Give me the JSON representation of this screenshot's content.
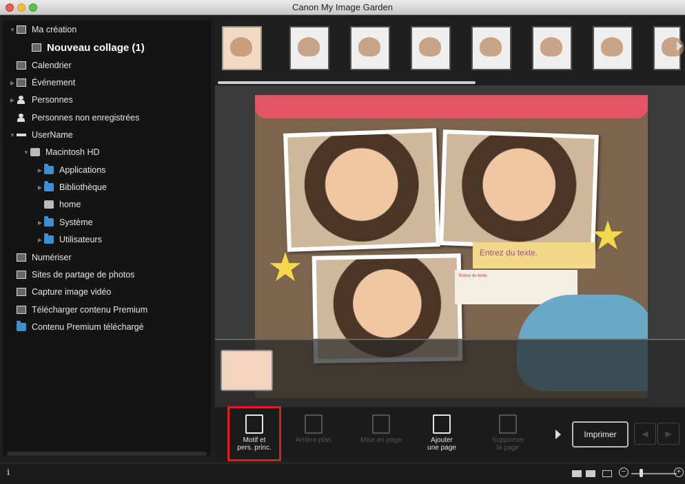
{
  "window": {
    "title": "Canon My Image Garden"
  },
  "sidebar": {
    "items": [
      {
        "label": "Ma création",
        "icon": "creation-icon",
        "level": 0,
        "expanded": true
      },
      {
        "label": "Nouveau collage (1)",
        "icon": "collage-icon",
        "level": 1,
        "selected": true
      },
      {
        "label": "Calendrier",
        "icon": "calendar-icon",
        "level": 0
      },
      {
        "label": "Événement",
        "icon": "event-icon",
        "level": 0
      },
      {
        "label": "Personnes",
        "icon": "people-icon",
        "level": 0
      },
      {
        "label": "Personnes non enregistrées",
        "icon": "unregistered-people-icon",
        "level": 0
      },
      {
        "label": "UserName",
        "icon": "drive-icon",
        "level": 0,
        "expanded": true
      },
      {
        "label": "Macintosh HD",
        "icon": "harddisk-icon",
        "level": 1,
        "expanded": true
      },
      {
        "label": "Applications",
        "icon": "folder-icon",
        "level": 2
      },
      {
        "label": "Bibliothèque",
        "icon": "folder-icon",
        "level": 2
      },
      {
        "label": "home",
        "icon": "home-icon",
        "level": 2
      },
      {
        "label": "Système",
        "icon": "folder-icon",
        "level": 2
      },
      {
        "label": "Utilisateurs",
        "icon": "folder-icon",
        "level": 2
      },
      {
        "label": "Numériser",
        "icon": "scan-icon",
        "level": 0
      },
      {
        "label": "Sites de partage de photos",
        "icon": "photo-share-icon",
        "level": 0
      },
      {
        "label": "Capture image vidéo",
        "icon": "video-capture-icon",
        "level": 0
      },
      {
        "label": "Télécharger contenu Premium",
        "icon": "download-premium-icon",
        "level": 0
      },
      {
        "label": "Contenu Premium téléchargé",
        "icon": "premium-folder-icon",
        "level": 0
      }
    ]
  },
  "canvas": {
    "textbox_main": "Entrez du texte.",
    "textbox_small": "Entrez du texte."
  },
  "toolbar": {
    "buttons": [
      {
        "label": "Motif et\npers. princ.",
        "enabled": true,
        "highlighted": true
      },
      {
        "label": "Arrière-plan",
        "enabled": false
      },
      {
        "label": "Mise en page",
        "enabled": false
      },
      {
        "label": "Ajouter\nune page",
        "enabled": true
      },
      {
        "label": "Supprimer\nla page",
        "enabled": false
      }
    ],
    "print_label": "Imprimer"
  },
  "colors": {
    "highlight": "#e21d1d",
    "folder": "#3d8fd6"
  }
}
